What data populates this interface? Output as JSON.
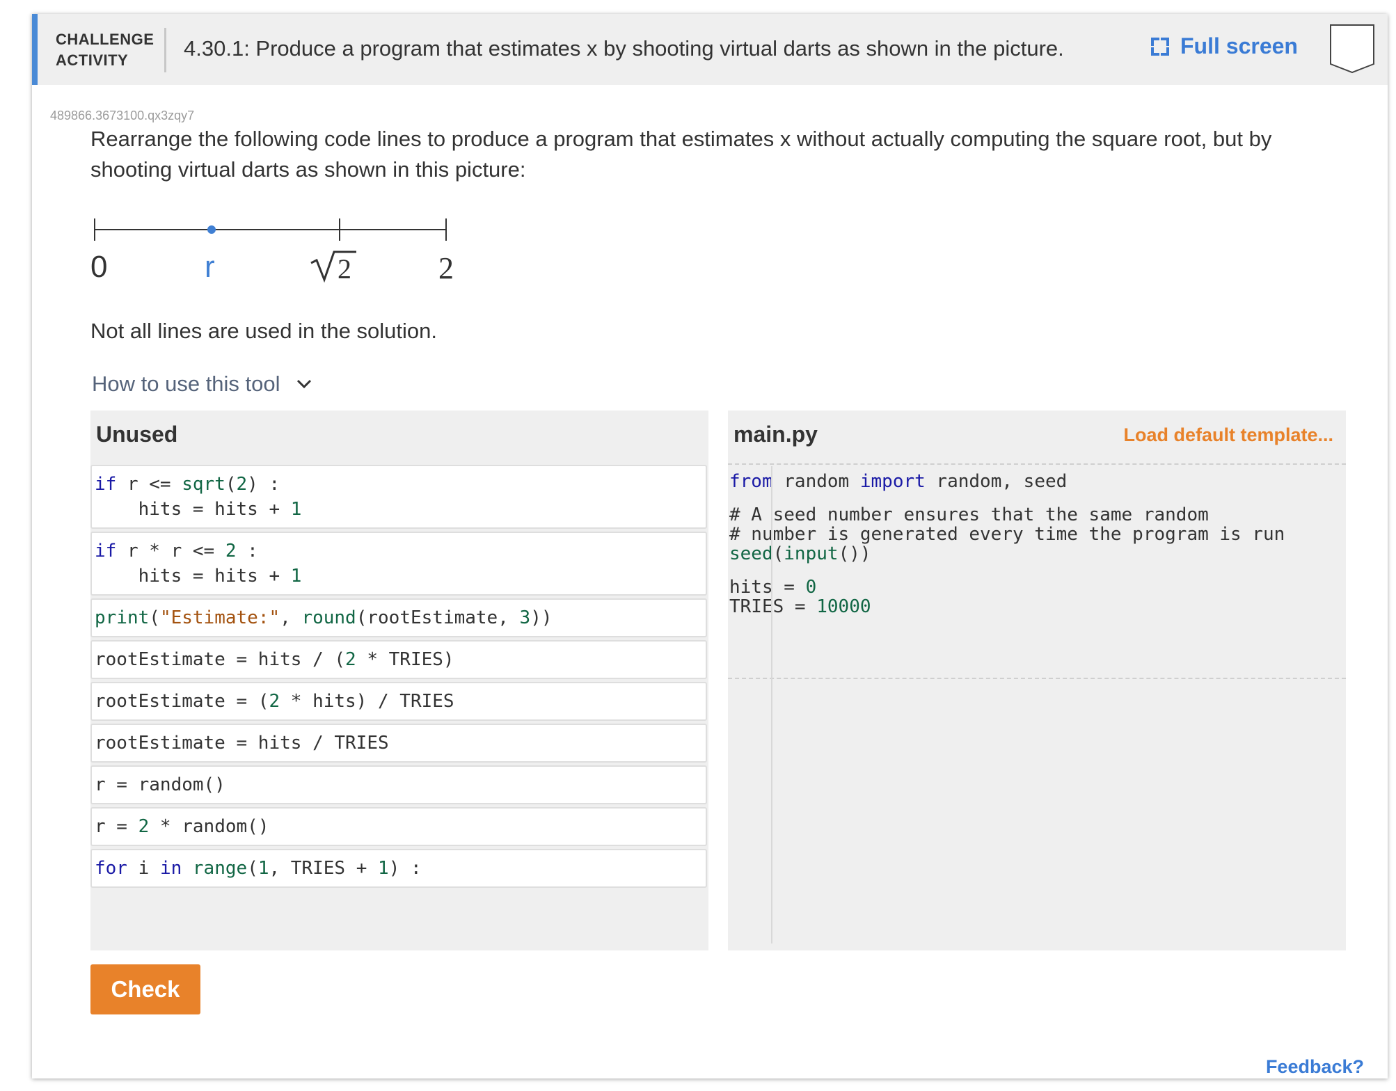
{
  "header": {
    "activity_label_line1": "CHALLENGE",
    "activity_label_line2": "ACTIVITY",
    "title": "4.30.1: Produce a program that estimates x by shooting virtual darts as shown in the picture.",
    "fullscreen_label": "Full screen",
    "accent_color": "#4a8ad6"
  },
  "activity_id": "489866.3673100.qx3zqy7",
  "instructions": "Rearrange the following code lines to produce a program that estimates x without actually computing the square root, but by shooting virtual darts as shown in this picture:",
  "diagram": {
    "label_zero": "0",
    "label_r": "r",
    "label_sqrt_value": "2",
    "label_two": "2"
  },
  "note": "Not all lines are used in the solution.",
  "howto": "How to use this tool",
  "unused": {
    "title": "Unused",
    "blocks": [
      {
        "lines": [
          "if r <= sqrt(2) :",
          "    hits = hits + 1"
        ]
      },
      {
        "lines": [
          "if r * r <= 2 :",
          "    hits = hits + 1"
        ]
      },
      {
        "lines": [
          "print(\"Estimate:\", round(rootEstimate, 3))"
        ]
      },
      {
        "lines": [
          "rootEstimate = hits / (2 * TRIES)"
        ]
      },
      {
        "lines": [
          "rootEstimate = (2 * hits) / TRIES"
        ]
      },
      {
        "lines": [
          "rootEstimate = hits / TRIES"
        ]
      },
      {
        "lines": [
          "r = random()"
        ]
      },
      {
        "lines": [
          "r = 2 * random()"
        ]
      },
      {
        "lines": [
          "for i in range(1, TRIES + 1) :"
        ]
      }
    ]
  },
  "main": {
    "title": "main.py",
    "load_template": "Load default template...",
    "code": [
      "from random import random, seed",
      "",
      "# A seed number ensures that the same random",
      "# number is generated every time the program is run",
      "seed(input())",
      "",
      "hits = 0",
      "TRIES = 10000"
    ]
  },
  "check_label": "Check",
  "feedback_label": "Feedback?",
  "colors": {
    "button": "#e8822a",
    "link": "#3a7bd5"
  }
}
